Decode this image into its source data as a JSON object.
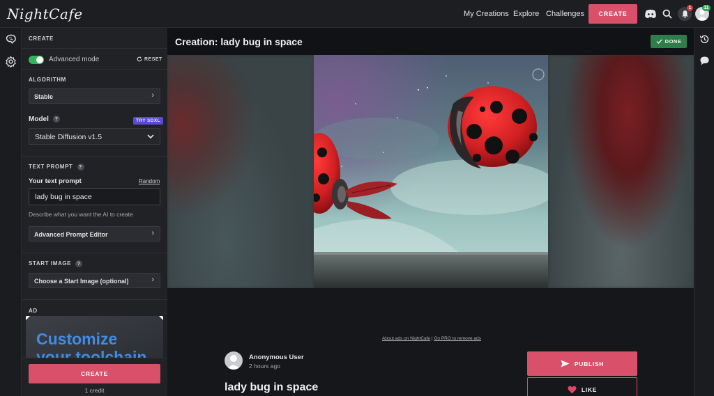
{
  "app": {
    "logo": "NightCafe"
  },
  "topnav": {
    "links": [
      "My Creations",
      "Explore",
      "Challenges"
    ],
    "create_label": "CREATE",
    "notification_count": "1",
    "avatar_badge": "11"
  },
  "sidebar": {
    "header": "CREATE",
    "advanced_mode_label": "Advanced mode",
    "advanced_mode_on": true,
    "reset_label": "RESET",
    "algorithm_header": "ALGORITHM",
    "algorithm_value": "Stable",
    "model_label": "Model",
    "model_badge": "TRY SDXL",
    "model_value": "Stable Diffusion v1.5",
    "text_prompt_header": "TEXT PROMPT",
    "your_prompt_label": "Your text prompt",
    "random_label": "Random",
    "prompt_value": "lady bug in space",
    "prompt_hint": "Describe what you want the AI to create",
    "advanced_editor_label": "Advanced Prompt Editor",
    "start_image_header": "START IMAGE",
    "start_image_label": "Choose a Start Image (optional)",
    "ad_header": "AD",
    "ad_line1": "Customize",
    "ad_line2": "your toolchain",
    "create_button": "CREATE",
    "credit_text": "1 credit"
  },
  "main": {
    "page_title": "Creation: lady bug in space",
    "done_label": "DONE",
    "ad_notice_1": "About ads on NightCafe",
    "ad_notice_sep": " | ",
    "ad_notice_2": "Go PRO to remove ads",
    "user_name": "Anonymous User",
    "user_time": "2 hours ago",
    "creation_title": "lady bug in space",
    "publish_label": "PUBLISH",
    "like_label": "LIKE"
  },
  "colors": {
    "accent": "#d9506a",
    "done": "#2e7d4a",
    "toggle": "#33b35a",
    "badge": "#5a4bd6"
  }
}
